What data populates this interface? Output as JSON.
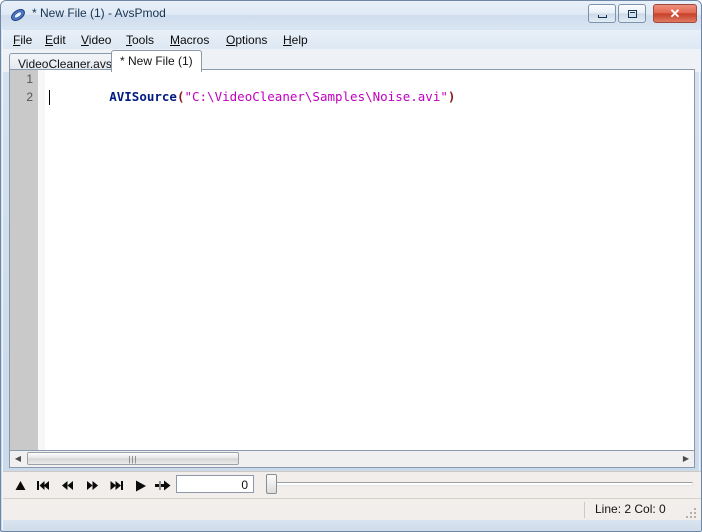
{
  "window": {
    "title": "* New File (1) - AvsPmod",
    "app_icon": "avspmod-logo-icon",
    "controls": {
      "minimize": "minimize-icon",
      "maximize": "maximize-icon",
      "close_label": "✕"
    }
  },
  "menubar": {
    "items": [
      {
        "label": "File",
        "accel": "F"
      },
      {
        "label": "Edit",
        "accel": "E"
      },
      {
        "label": "Video",
        "accel": "V"
      },
      {
        "label": "Tools",
        "accel": "T"
      },
      {
        "label": "Macros",
        "accel": "M"
      },
      {
        "label": "Options",
        "accel": "O"
      },
      {
        "label": "Help",
        "accel": "H"
      }
    ]
  },
  "tabs": {
    "items": [
      {
        "label": "VideoCleaner.avs",
        "active": false
      },
      {
        "label": "* New File (1)",
        "active": true
      }
    ]
  },
  "editor": {
    "line_numbers": [
      "1",
      "2"
    ],
    "lines": [
      {
        "number": "1",
        "tokens": [
          {
            "text": "AVISource",
            "kind": "function"
          },
          {
            "text": "(",
            "kind": "paren"
          },
          {
            "text": "\"C:\\VideoCleaner\\Samples\\Noise.avi\"",
            "kind": "string"
          },
          {
            "text": ")",
            "kind": "paren"
          }
        ],
        "plain": "AVISource(\"C:\\VideoCleaner\\Samples\\Noise.avi\")"
      },
      {
        "number": "2",
        "tokens": [],
        "plain": ""
      }
    ],
    "current_line": 2,
    "colors": {
      "function": "#001c80",
      "paren": "#8b1a1a",
      "string": "#c000c0",
      "current_line_bg": "#e6e6fa",
      "gutter_bg": "#c9c9c9"
    }
  },
  "scrollbars": {
    "horizontal": {
      "left_arrow": "◀",
      "right_arrow": "▶",
      "thumb_grip": "|||"
    }
  },
  "playbar": {
    "buttons": [
      {
        "name": "refresh-preview-button",
        "glyph": "▲"
      },
      {
        "name": "skip-to-start-button",
        "glyph": "⏮"
      },
      {
        "name": "step-back-button",
        "glyph": "⏪"
      },
      {
        "name": "step-forward-button",
        "glyph": "⏩"
      },
      {
        "name": "skip-to-end-button",
        "glyph": "⏭"
      },
      {
        "name": "play-button",
        "glyph": "▶"
      },
      {
        "name": "goto-frame-button",
        "glyph": "→"
      }
    ],
    "frame_value": "0",
    "frame_placeholder": "0",
    "slider_position": "0"
  },
  "statusbar": {
    "text": "Line: 2  Col: 0",
    "line": "2",
    "col": "0"
  }
}
